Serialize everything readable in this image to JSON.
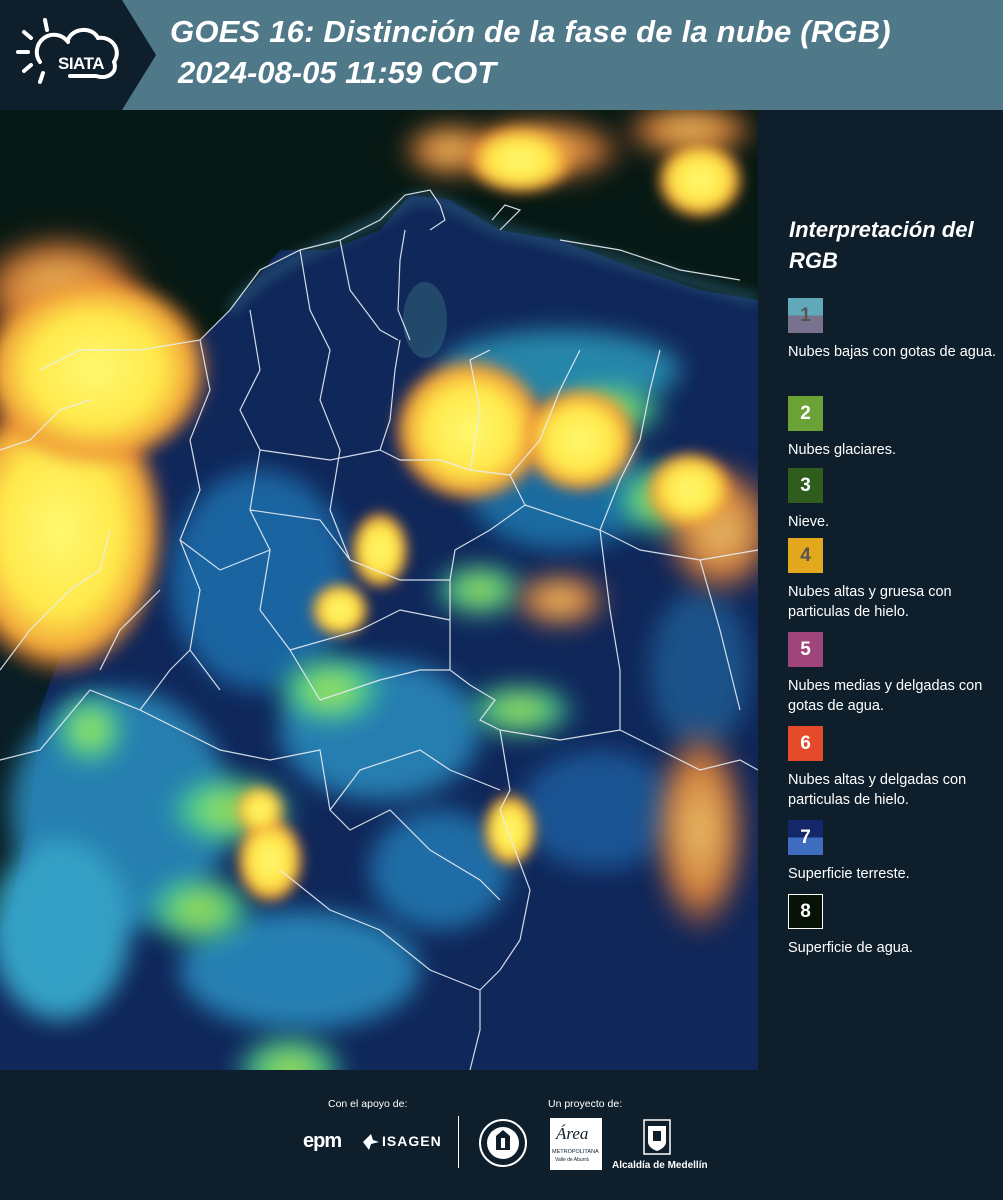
{
  "header": {
    "logo_text": "SIATA",
    "title_line1": "GOES 16: Distinción de la fase de la nube (RGB)",
    "title_line2": "2024-08-05 11:59 COT"
  },
  "legend": {
    "title": "Interpretación del RGB",
    "items": [
      {
        "num": "1",
        "label": "Nubes bajas con gotas de agua.",
        "color_top": "#5fa9b8",
        "color_bottom": "#78728f",
        "num_color": "#555555"
      },
      {
        "num": "2",
        "label": "Nubes glaciares.",
        "color_top": "#6aa235",
        "color_bottom": "#6aa235",
        "num_color": "#ffffff"
      },
      {
        "num": "3",
        "label": "Nieve.",
        "color_top": "#2e5d1e",
        "color_bottom": "#2e5d1e",
        "num_color": "#ffffff"
      },
      {
        "num": "4",
        "label": "Nubes altas y gruesa con particulas de hielo.",
        "color_top": "#e3a81d",
        "color_bottom": "#e3a81d",
        "num_color": "#555555"
      },
      {
        "num": "5",
        "label": "Nubes medias y delgadas con gotas de agua.",
        "color_top": "#a0457b",
        "color_bottom": "#a0457b",
        "num_color": "#ffffff"
      },
      {
        "num": "6",
        "label": "Nubes altas y delgadas con particulas de hielo.",
        "color_top": "#e54a2a",
        "color_bottom": "#e54a2a",
        "num_color": "#ffffff"
      },
      {
        "num": "7",
        "label": "Superficie terreste.",
        "color_top": "#14276b",
        "color_bottom": "#3e6dc0",
        "num_color": "#ffffff"
      },
      {
        "num": "8",
        "label": "Superficie de agua.",
        "color_top": "#071207",
        "color_bottom": "#071207",
        "num_color": "#ffffff",
        "border": "#ffffff"
      }
    ]
  },
  "footer": {
    "support_label": "Con el apoyo de:",
    "project_label": "Un proyecto de:",
    "sponsor_epm": "epm",
    "sponsor_isagen": "ISAGEN",
    "area_text": "Área",
    "area_sub": "METROPOLITANA",
    "area_sub2": "Valle de Aburrá",
    "alcaldia": "Alcaldía de Medellín"
  },
  "colors": {
    "background": "#0e1f2b",
    "header_band": "#4f7888",
    "land": "#10275a",
    "cloud_yellow": "#fff35a"
  }
}
